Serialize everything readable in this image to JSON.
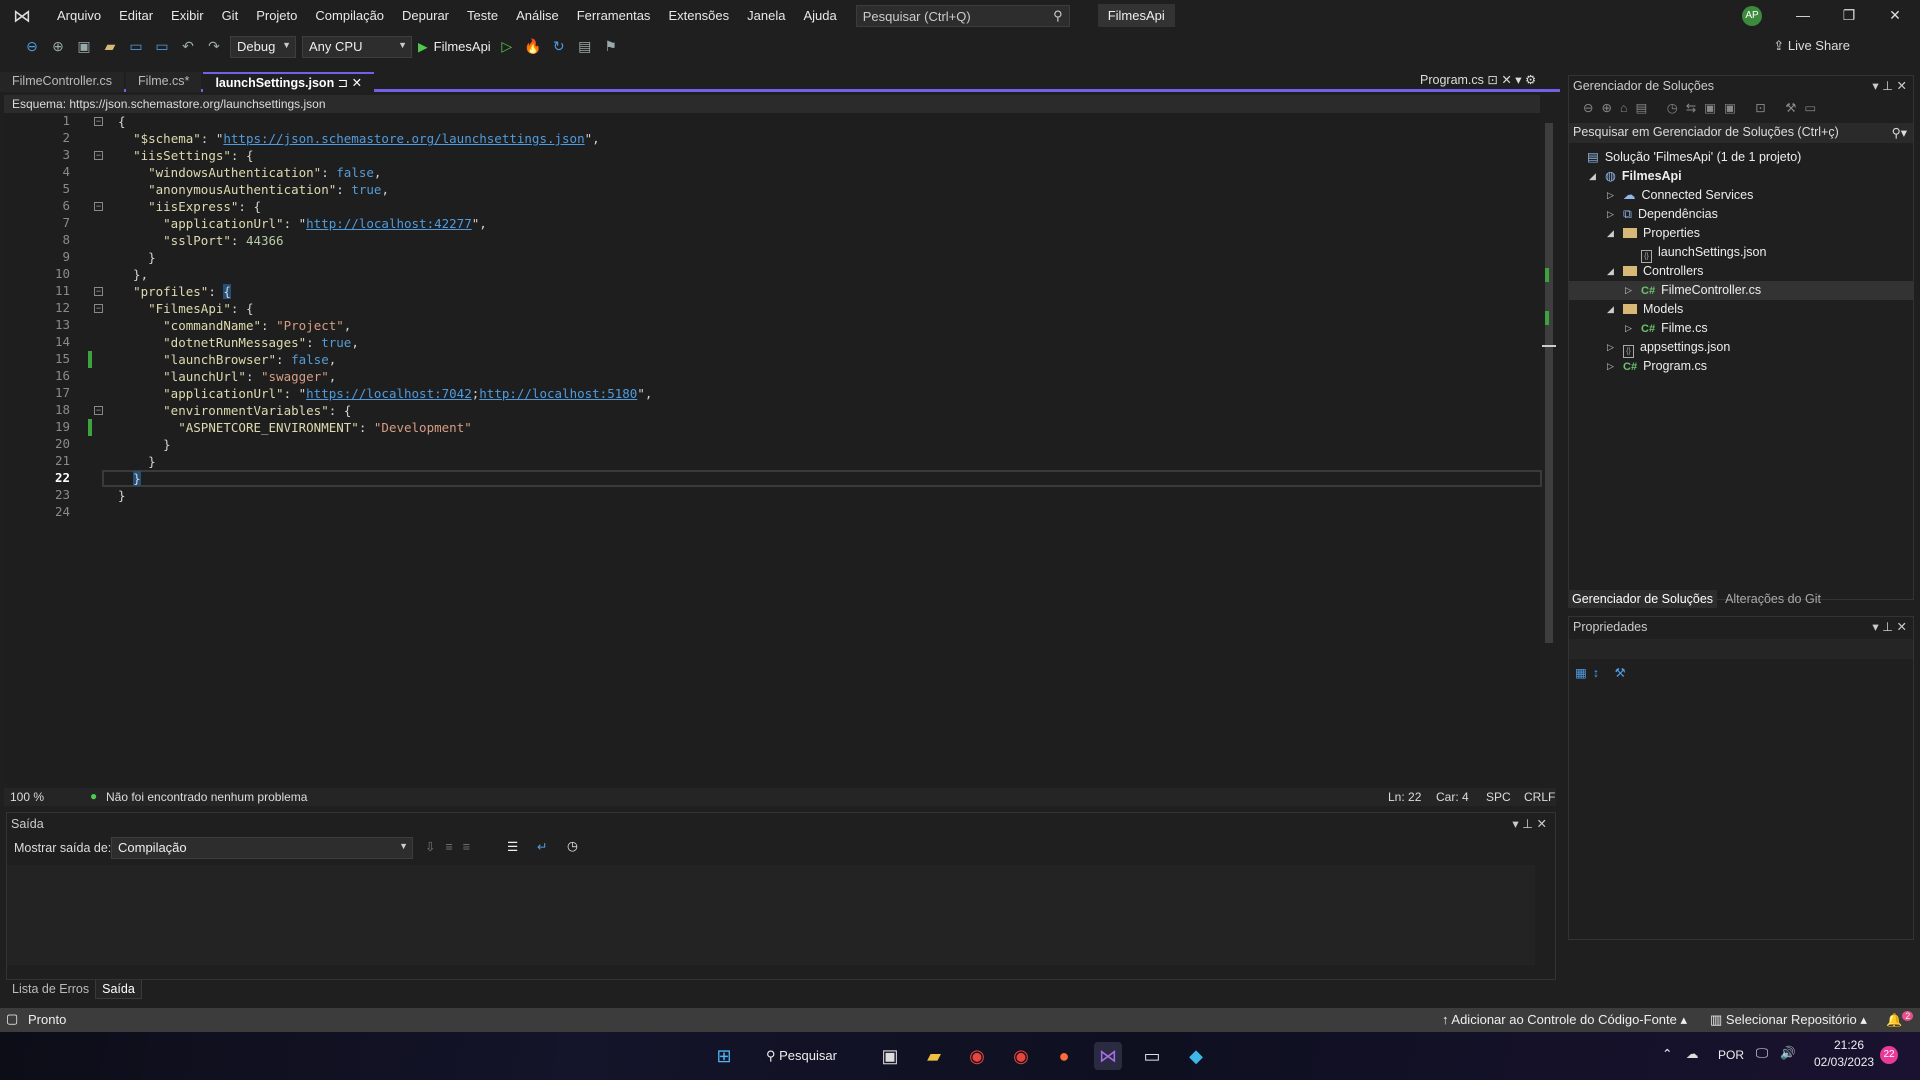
{
  "menubar": {
    "items": [
      "Arquivo",
      "Editar",
      "Exibir",
      "Git",
      "Projeto",
      "Compilação",
      "Depurar",
      "Teste",
      "Análise",
      "Ferramentas",
      "Extensões",
      "Janela",
      "Ajuda"
    ],
    "search_placeholder": "Pesquisar (Ctrl+Q)",
    "title": "FilmesApi",
    "avatar": "AP"
  },
  "toolbar": {
    "config": "Debug",
    "platform": "Any CPU",
    "run_target": "FilmesApi",
    "live_share": "Live Share"
  },
  "tabs": [
    {
      "label": "FilmeController.cs",
      "active": false
    },
    {
      "label": "Filme.cs*",
      "active": false
    },
    {
      "label": "launchSettings.json",
      "active": true
    }
  ],
  "right_tab": "Program.cs",
  "schema": {
    "label": "Esquema:",
    "value": "https://json.schemastore.org/launchsettings.json"
  },
  "editor": {
    "current_line": 22,
    "lines": [
      [
        [
          "p",
          "{"
        ]
      ],
      [
        [
          "p",
          "  "
        ],
        [
          "k",
          "\"$schema\""
        ],
        [
          "p",
          ": \""
        ],
        [
          "u",
          "https://json.schemastore.org/launchsettings.json"
        ],
        [
          "p",
          "\","
        ]
      ],
      [
        [
          "p",
          "  "
        ],
        [
          "k",
          "\"iisSettings\""
        ],
        [
          "p",
          ": {"
        ]
      ],
      [
        [
          "p",
          "    "
        ],
        [
          "k",
          "\"windowsAuthentication\""
        ],
        [
          "p",
          ": "
        ],
        [
          "b",
          "false"
        ],
        [
          "p",
          ","
        ]
      ],
      [
        [
          "p",
          "    "
        ],
        [
          "k",
          "\"anonymousAuthentication\""
        ],
        [
          "p",
          ": "
        ],
        [
          "b",
          "true"
        ],
        [
          "p",
          ","
        ]
      ],
      [
        [
          "p",
          "    "
        ],
        [
          "k",
          "\"iisExpress\""
        ],
        [
          "p",
          ": {"
        ]
      ],
      [
        [
          "p",
          "      "
        ],
        [
          "k",
          "\"applicationUrl\""
        ],
        [
          "p",
          ": \""
        ],
        [
          "u",
          "http://localhost:42277"
        ],
        [
          "p",
          "\","
        ]
      ],
      [
        [
          "p",
          "      "
        ],
        [
          "k",
          "\"sslPort\""
        ],
        [
          "p",
          ": "
        ],
        [
          "n",
          "44366"
        ]
      ],
      [
        [
          "p",
          "    }"
        ]
      ],
      [
        [
          "p",
          "  },"
        ]
      ],
      [
        [
          "p",
          "  "
        ],
        [
          "k",
          "\"profiles\""
        ],
        [
          "p",
          ": "
        ],
        [
          "h",
          "{"
        ]
      ],
      [
        [
          "p",
          "    "
        ],
        [
          "k",
          "\"FilmesApi\""
        ],
        [
          "p",
          ": {"
        ]
      ],
      [
        [
          "p",
          "      "
        ],
        [
          "k",
          "\"commandName\""
        ],
        [
          "p",
          ": "
        ],
        [
          "s",
          "\"Project\""
        ],
        [
          "p",
          ","
        ]
      ],
      [
        [
          "p",
          "      "
        ],
        [
          "k",
          "\"dotnetRunMessages\""
        ],
        [
          "p",
          ": "
        ],
        [
          "b",
          "true"
        ],
        [
          "p",
          ","
        ]
      ],
      [
        [
          "p",
          "      "
        ],
        [
          "k",
          "\"launchBrowser\""
        ],
        [
          "p",
          ": "
        ],
        [
          "b",
          "false"
        ],
        [
          "p",
          ","
        ]
      ],
      [
        [
          "p",
          "      "
        ],
        [
          "k",
          "\"launchUrl\""
        ],
        [
          "p",
          ": "
        ],
        [
          "s",
          "\"swagger\""
        ],
        [
          "p",
          ","
        ]
      ],
      [
        [
          "p",
          "      "
        ],
        [
          "k",
          "\"applicationUrl\""
        ],
        [
          "p",
          ": \""
        ],
        [
          "u",
          "https://localhost:7042"
        ],
        [
          "p",
          ";"
        ],
        [
          "u",
          "http://localhost:5180"
        ],
        [
          "p",
          "\","
        ]
      ],
      [
        [
          "p",
          "      "
        ],
        [
          "k",
          "\"environmentVariables\""
        ],
        [
          "p",
          ": {"
        ]
      ],
      [
        [
          "p",
          "        "
        ],
        [
          "k",
          "\"ASPNETCORE_ENVIRONMENT\""
        ],
        [
          "p",
          ": "
        ],
        [
          "s",
          "\"Development\""
        ]
      ],
      [
        [
          "p",
          "      }"
        ]
      ],
      [
        [
          "p",
          "    }"
        ]
      ],
      [
        [
          "p",
          "  "
        ],
        [
          "h",
          "}"
        ]
      ],
      [
        [
          "p",
          "}"
        ]
      ],
      []
    ],
    "fold_lines": [
      1,
      3,
      6,
      11,
      12,
      18
    ],
    "changed_lines": [
      15,
      19
    ]
  },
  "editor_status": {
    "zoom": "100 %",
    "issues": "Não foi encontrado nenhum problema",
    "ln": "Ln: 22",
    "car": "Car: 4",
    "spc": "SPC",
    "crlf": "CRLF"
  },
  "output": {
    "title": "Saída",
    "show_from_label": "Mostrar saída de:",
    "show_from_value": "Compilação"
  },
  "bottom_tabs": [
    "Lista de Erros",
    "Saída"
  ],
  "solution_explorer": {
    "title": "Gerenciador de Soluções",
    "search_placeholder": "Pesquisar em Gerenciador de Soluções (Ctrl+ç)",
    "items": [
      {
        "label": "Solução 'FilmesApi' (1 de 1 projeto)",
        "level": 0,
        "icon": "solution-icon",
        "expander": ""
      },
      {
        "label": "FilmesApi",
        "level": 0,
        "icon": "project-icon",
        "expander": "open",
        "bold": true
      },
      {
        "label": "Connected Services",
        "level": 1,
        "icon": "connected-services-icon",
        "expander": "closed"
      },
      {
        "label": "Dependências",
        "level": 1,
        "icon": "dependencies-icon",
        "expander": "closed"
      },
      {
        "label": "Properties",
        "level": 1,
        "icon": "folder-icon",
        "expander": "open"
      },
      {
        "label": "launchSettings.json",
        "level": 2,
        "icon": "json-file-icon",
        "expander": ""
      },
      {
        "label": "Controllers",
        "level": 1,
        "icon": "folder-icon",
        "expander": "open"
      },
      {
        "label": "FilmeController.cs",
        "level": 2,
        "icon": "csharp-file-icon",
        "expander": "closed",
        "selected": true
      },
      {
        "label": "Models",
        "level": 1,
        "icon": "folder-icon",
        "expander": "open"
      },
      {
        "label": "Filme.cs",
        "level": 2,
        "icon": "csharp-file-icon",
        "expander": "closed"
      },
      {
        "label": "appsettings.json",
        "level": 1,
        "icon": "json-file-icon",
        "expander": "closed"
      },
      {
        "label": "Program.cs",
        "level": 1,
        "icon": "csharp-file-icon",
        "expander": "closed"
      }
    ],
    "tabs": [
      "Gerenciador de Soluções",
      "Alterações do Git"
    ]
  },
  "properties": {
    "title": "Propriedades"
  },
  "statusbar": {
    "ready": "Pronto",
    "add_source_control": "Adicionar ao Controle do Código-Fonte",
    "select_repo": "Selecionar Repositório",
    "notifications": "2"
  },
  "taskbar": {
    "search": "Pesquisar",
    "lang": "POR",
    "time": "21:26",
    "date": "02/03/2023",
    "badge": "22"
  },
  "colors": {
    "accent": "#7160e8",
    "changed": "#3da33d",
    "link": "#4f9be0"
  }
}
